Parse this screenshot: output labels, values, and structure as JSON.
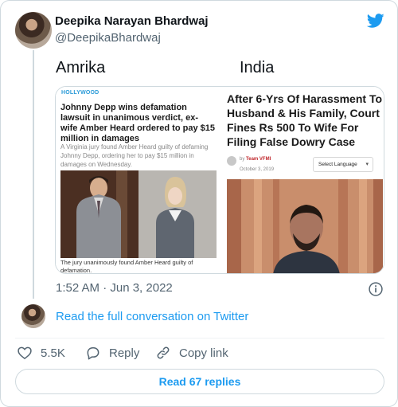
{
  "author": {
    "name": "Deepika Narayan Bhardwaj",
    "handle": "@DeepikaBhardwaj"
  },
  "tweet": {
    "text_left": "Amrika",
    "text_right": "India",
    "timestamp": "1:52 AM · Jun 3, 2022"
  },
  "media": {
    "left": {
      "label": "HOLLYWOOD",
      "headline": "Johnny Depp wins defamation lawsuit in unanimous verdict, ex-wife Amber Heard ordered to pay $15 million in damages",
      "subtext": "A Virginia jury found Amber Heard guilty of defaming Johnny Depp, ordering her to pay $15 million in damages on Wednesday.",
      "caption": "The jury unanimously found Amber Heard guilty of defamation."
    },
    "right": {
      "headline": "After 6-Yrs Of Harassment To Husband & His Family, Court Fines Rs 500 To Wife For Filing False Dowry Case",
      "by": "by",
      "author": "Team VFMI",
      "date": "October 3, 2019",
      "language_select": "Select Language"
    }
  },
  "links": {
    "read_conversation": "Read the full conversation on Twitter"
  },
  "actions": {
    "likes": "5.5K",
    "reply": "Reply",
    "copy_link": "Copy link"
  },
  "replies_button": "Read 67 replies",
  "colors": {
    "accent": "#1d9bf0",
    "secondary_text": "#536471",
    "border": "#cfd9de"
  },
  "icons": [
    "twitter-bird-icon",
    "info-icon",
    "heart-icon",
    "reply-bubble-icon",
    "link-icon",
    "chevron-down-icon"
  ]
}
